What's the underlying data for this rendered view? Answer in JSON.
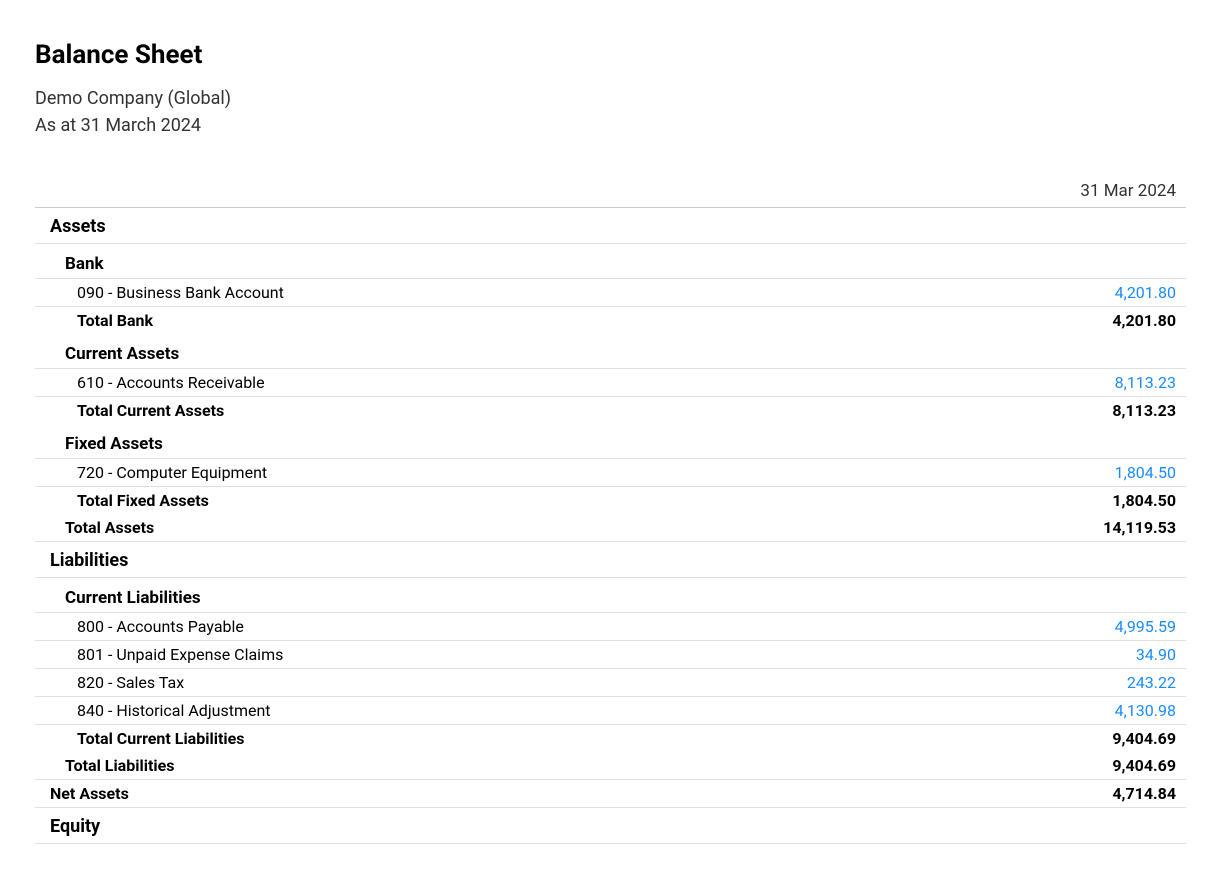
{
  "report": {
    "title": "Balance Sheet",
    "company": "Demo Company (Global)",
    "asAt": "As at 31 March 2024",
    "columnDate": "31 Mar 2024"
  },
  "assets": {
    "heading": "Assets",
    "bank": {
      "heading": "Bank",
      "lines": [
        {
          "label": "090 - Business Bank Account",
          "value": "4,201.80"
        }
      ],
      "totalLabel": "Total Bank",
      "totalValue": "4,201.80"
    },
    "currentAssets": {
      "heading": "Current Assets",
      "lines": [
        {
          "label": "610 - Accounts Receivable",
          "value": "8,113.23"
        }
      ],
      "totalLabel": "Total Current Assets",
      "totalValue": "8,113.23"
    },
    "fixedAssets": {
      "heading": "Fixed Assets",
      "lines": [
        {
          "label": "720 - Computer Equipment",
          "value": "1,804.50"
        }
      ],
      "totalLabel": "Total Fixed Assets",
      "totalValue": "1,804.50"
    },
    "totalLabel": "Total Assets",
    "totalValue": "14,119.53"
  },
  "liabilities": {
    "heading": "Liabilities",
    "currentLiabilities": {
      "heading": "Current Liabilities",
      "lines": [
        {
          "label": "800 - Accounts Payable",
          "value": "4,995.59"
        },
        {
          "label": "801 - Unpaid Expense Claims",
          "value": "34.90"
        },
        {
          "label": "820 - Sales Tax",
          "value": "243.22"
        },
        {
          "label": "840 - Historical Adjustment",
          "value": "4,130.98"
        }
      ],
      "totalLabel": "Total Current Liabilities",
      "totalValue": "9,404.69"
    },
    "totalLabel": "Total Liabilities",
    "totalValue": "9,404.69"
  },
  "netAssets": {
    "label": "Net Assets",
    "value": "4,714.84"
  },
  "equity": {
    "heading": "Equity"
  }
}
